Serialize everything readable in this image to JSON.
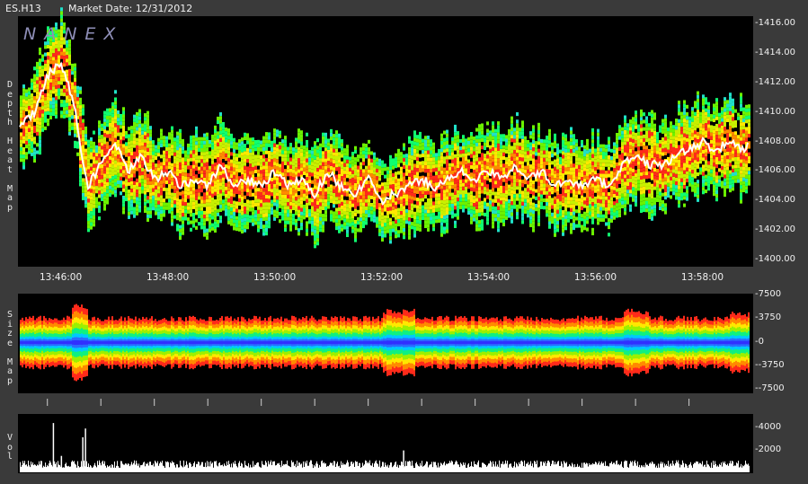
{
  "header": {
    "symbol": "ES.H13",
    "market_date_label": "Market Date: 12/31/2012"
  },
  "logo_text": "NANEX",
  "panels": {
    "depth_label": "Depth Heat Map",
    "size_label": "Size Map",
    "vol_label": "Vol"
  },
  "chart_data": [
    {
      "type": "heatmap",
      "panel": "depth",
      "x_ticks": [
        "13:46:00",
        "13:48:00",
        "13:50:00",
        "13:52:00",
        "13:54:00",
        "13:56:00",
        "13:58:00"
      ],
      "x_tick_minutes": [
        46,
        48,
        50,
        52,
        54,
        56,
        58
      ],
      "xlim_minutes": [
        45.2,
        58.95
      ],
      "y_ticks": [
        "1416.00",
        "1414.00",
        "1412.00",
        "1410.00",
        "1408.00",
        "1406.00",
        "1404.00",
        "1402.00",
        "1400.00"
      ],
      "ylim": [
        1400,
        1416
      ],
      "price_path": {
        "minute": [
          45.25,
          45.5,
          45.75,
          46.0,
          46.25,
          46.5,
          46.75,
          47.0,
          47.25,
          47.5,
          47.75,
          48.0,
          48.25,
          48.5,
          48.75,
          49.0,
          49.25,
          49.5,
          49.75,
          50.0,
          50.25,
          50.5,
          50.75,
          51.0,
          51.25,
          51.5,
          51.75,
          52.0,
          52.25,
          52.5,
          52.75,
          53.0,
          53.25,
          53.5,
          53.75,
          54.0,
          54.25,
          54.5,
          54.75,
          55.0,
          55.25,
          55.5,
          55.75,
          56.0,
          56.25,
          56.5,
          56.75,
          57.0,
          57.25,
          57.5,
          57.75,
          58.0,
          58.25,
          58.5,
          58.75,
          58.9
        ],
        "price": [
          1409.0,
          1410.0,
          1412.5,
          1413.5,
          1410.5,
          1405.0,
          1406.5,
          1408.0,
          1406.0,
          1407.0,
          1405.5,
          1406.0,
          1405.0,
          1405.5,
          1405.0,
          1406.5,
          1405.0,
          1405.5,
          1405.0,
          1406.0,
          1405.0,
          1405.5,
          1404.5,
          1406.0,
          1405.0,
          1404.5,
          1405.5,
          1404.0,
          1404.5,
          1405.0,
          1405.5,
          1405.0,
          1405.5,
          1406.0,
          1405.5,
          1406.0,
          1405.5,
          1406.5,
          1405.5,
          1406.0,
          1405.0,
          1405.5,
          1405.0,
          1405.5,
          1405.0,
          1406.5,
          1407.0,
          1406.5,
          1406.5,
          1407.0,
          1407.5,
          1408.0,
          1407.5,
          1408.0,
          1407.5,
          1408.0
        ]
      }
    },
    {
      "type": "heatmap",
      "panel": "size",
      "y_ticks": [
        "7500",
        "3750",
        "0",
        "-3750",
        "-7500"
      ],
      "ylim": [
        -7500,
        7500
      ]
    },
    {
      "type": "bar",
      "panel": "volume",
      "y_ticks": [
        "4000",
        "2000"
      ],
      "ylim": [
        0,
        5000
      ],
      "spikes": [
        {
          "minute": 45.85,
          "value": 4500
        },
        {
          "minute": 46.0,
          "value": 1500
        },
        {
          "minute": 46.4,
          "value": 3200
        },
        {
          "minute": 46.45,
          "value": 4000
        },
        {
          "minute": 52.4,
          "value": 2000
        }
      ]
    }
  ],
  "colors": {
    "background": "#3a3a3a",
    "plot_bg": "#000000",
    "depth_palette": [
      "#ff2a1a",
      "#ff8a00",
      "#ffe800",
      "#c8f000",
      "#6cf200",
      "#10ff70",
      "#20e0c8"
    ],
    "size_palette": [
      "#ff2a1a",
      "#ff8a00",
      "#ffe800",
      "#9cf000",
      "#10f080",
      "#00c8ff",
      "#2a6cff",
      "#3030ff"
    ]
  }
}
